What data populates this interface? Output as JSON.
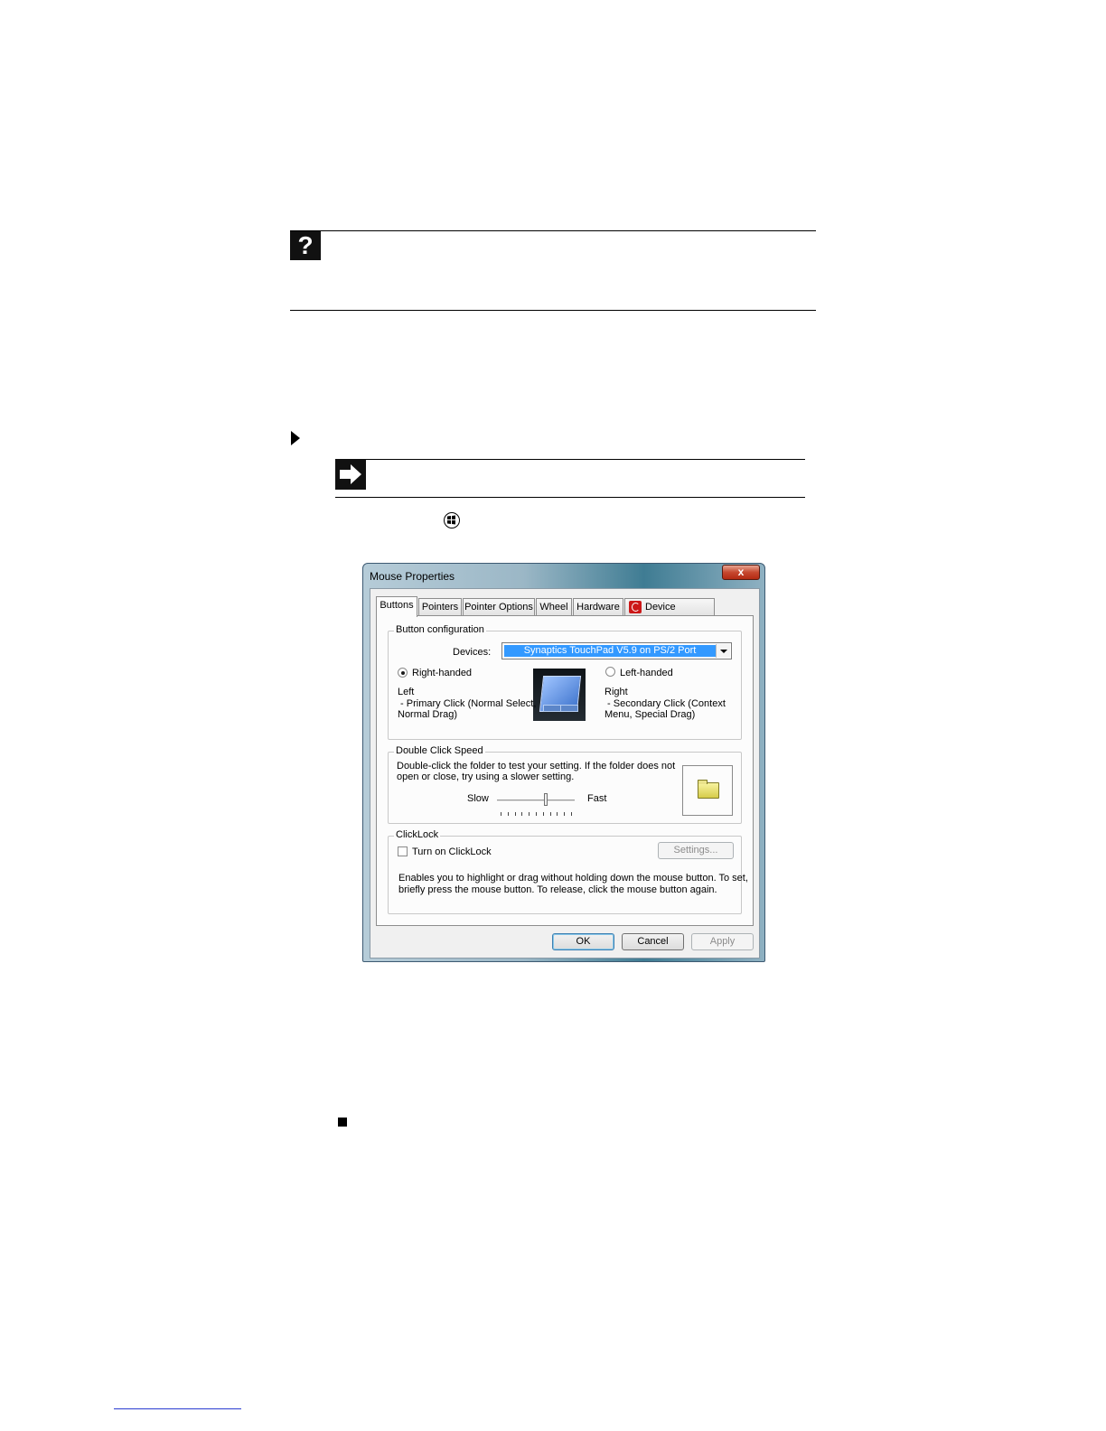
{
  "help_callout": {
    "icon": "question-icon",
    "glyph": "?"
  },
  "tip_callout": {
    "icon": "arrow-right-icon"
  },
  "step_bullet": {
    "icon": "triangle-bullet-icon"
  },
  "start_button": {
    "icon": "windows-start-icon"
  },
  "end_marker": {
    "icon": "end-square-icon"
  },
  "dialog": {
    "title": "Mouse Properties",
    "close_glyph": "x",
    "tabs": [
      {
        "label": "Buttons"
      },
      {
        "label": "Pointers"
      },
      {
        "label": "Pointer Options"
      },
      {
        "label": "Wheel"
      },
      {
        "label": "Hardware"
      },
      {
        "label": "Device Settings"
      }
    ],
    "button_config": {
      "group_label": "Button configuration",
      "devices_label": "Devices:",
      "devices_value": "Synaptics TouchPad V5.9 on PS/2 Port",
      "right_handed_label": "Right-handed",
      "right_handed_selected": true,
      "left_handed_label": "Left-handed",
      "left_handed_selected": false,
      "left_title": "Left",
      "left_desc_1": " - Primary Click (Normal Select,",
      "left_desc_2": "Normal Drag)",
      "right_title": "Right",
      "right_desc_1": " - Secondary Click (Context",
      "right_desc_2": "Menu, Special Drag)"
    },
    "double_click": {
      "group_label": "Double Click Speed",
      "desc_1": "Double-click the folder to test your setting.  If the folder does not",
      "desc_2": "open or close, try using a slower setting.",
      "slow_label": "Slow",
      "fast_label": "Fast",
      "speed_fraction": 0.625,
      "tick_count": 11
    },
    "clicklock": {
      "group_label": "ClickLock",
      "checkbox_label": "Turn on ClickLock",
      "checked": false,
      "settings_label": "Settings...",
      "desc_1": "Enables you to highlight or drag without holding down the mouse button.  To set,",
      "desc_2": "briefly press the mouse button.  To release, click the mouse button again."
    },
    "ok_label": "OK",
    "cancel_label": "Cancel",
    "apply_label": "Apply"
  }
}
